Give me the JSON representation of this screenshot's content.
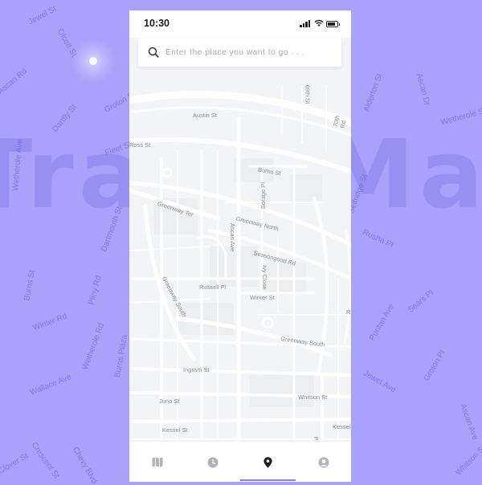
{
  "app": {
    "brand_watermark": "TravelMa",
    "accent_color": "#8a7cf3",
    "background_color": "#a8a2fb"
  },
  "status_bar": {
    "time": "10:30",
    "icons": [
      "signal-icon",
      "wifi-icon",
      "battery-icon"
    ]
  },
  "search": {
    "placeholder": "Enter the place you want to go . . .",
    "value": "",
    "icon": "search-icon"
  },
  "map": {
    "streets": {
      "austin": "Austin St",
      "ross": "Ross St",
      "burns": "Burns St",
      "borage": "Borage Pl",
      "greenway_ter": "Greenway Ter",
      "greenway_north": "Greenway North",
      "ascan": "Ascan Ave",
      "seasongood": "Seasongood Rd",
      "ivy": "Ivy Close",
      "russell": "Russell Pl",
      "winter": "Winter St",
      "greenway_south": "Greenway South",
      "greenway_south_2": "Greenway South",
      "ingram": "Ingram St",
      "juno": "Juno St",
      "whitson": "Whitson St",
      "kessel": "Kessel St",
      "kessel_2": "Kessel",
      "purit": "Purit",
      "top_1": "69th St",
      "top_2": "70th Rd",
      "right_cut": "R"
    },
    "pin_icon": "location-pin-icon"
  },
  "background_streets": {
    "s1": "Jewel St",
    "s2": "Olcott St",
    "s3": "Ascan Rd",
    "s4": "Groton St",
    "s5": "Dartfly St",
    "s6": "Alderton St",
    "s7": "Ascan Dr",
    "s8": "Wetherole St",
    "s9": "Fleet St",
    "s10": "Selfridge St",
    "s11": "Dartmouth St",
    "s12": "Rusha Pl",
    "s13": "Sears Pl",
    "s14": "Burns St",
    "s15": "Pliny Rd",
    "s16": "Wallace Ave",
    "s17": "Wetherole Rd",
    "s18": "Burns Plaza",
    "s19": "Puritan Ave",
    "s20": "Ascan Ave",
    "s21": "Clover St",
    "s22": "Chevy Blvd",
    "s23": "Whitson St",
    "s24": "Crescent St",
    "s25": "Wetherole Ave",
    "s26": "Winter Rd",
    "s27": "Groton Pl",
    "s28": "Jewel Ave"
  },
  "tabs": [
    {
      "name": "map-tab",
      "icon": "map-icon"
    },
    {
      "name": "history-tab",
      "icon": "clock-icon"
    },
    {
      "name": "location-tab",
      "icon": "location-pin-icon",
      "active": true
    },
    {
      "name": "profile-tab",
      "icon": "profile-icon"
    }
  ]
}
